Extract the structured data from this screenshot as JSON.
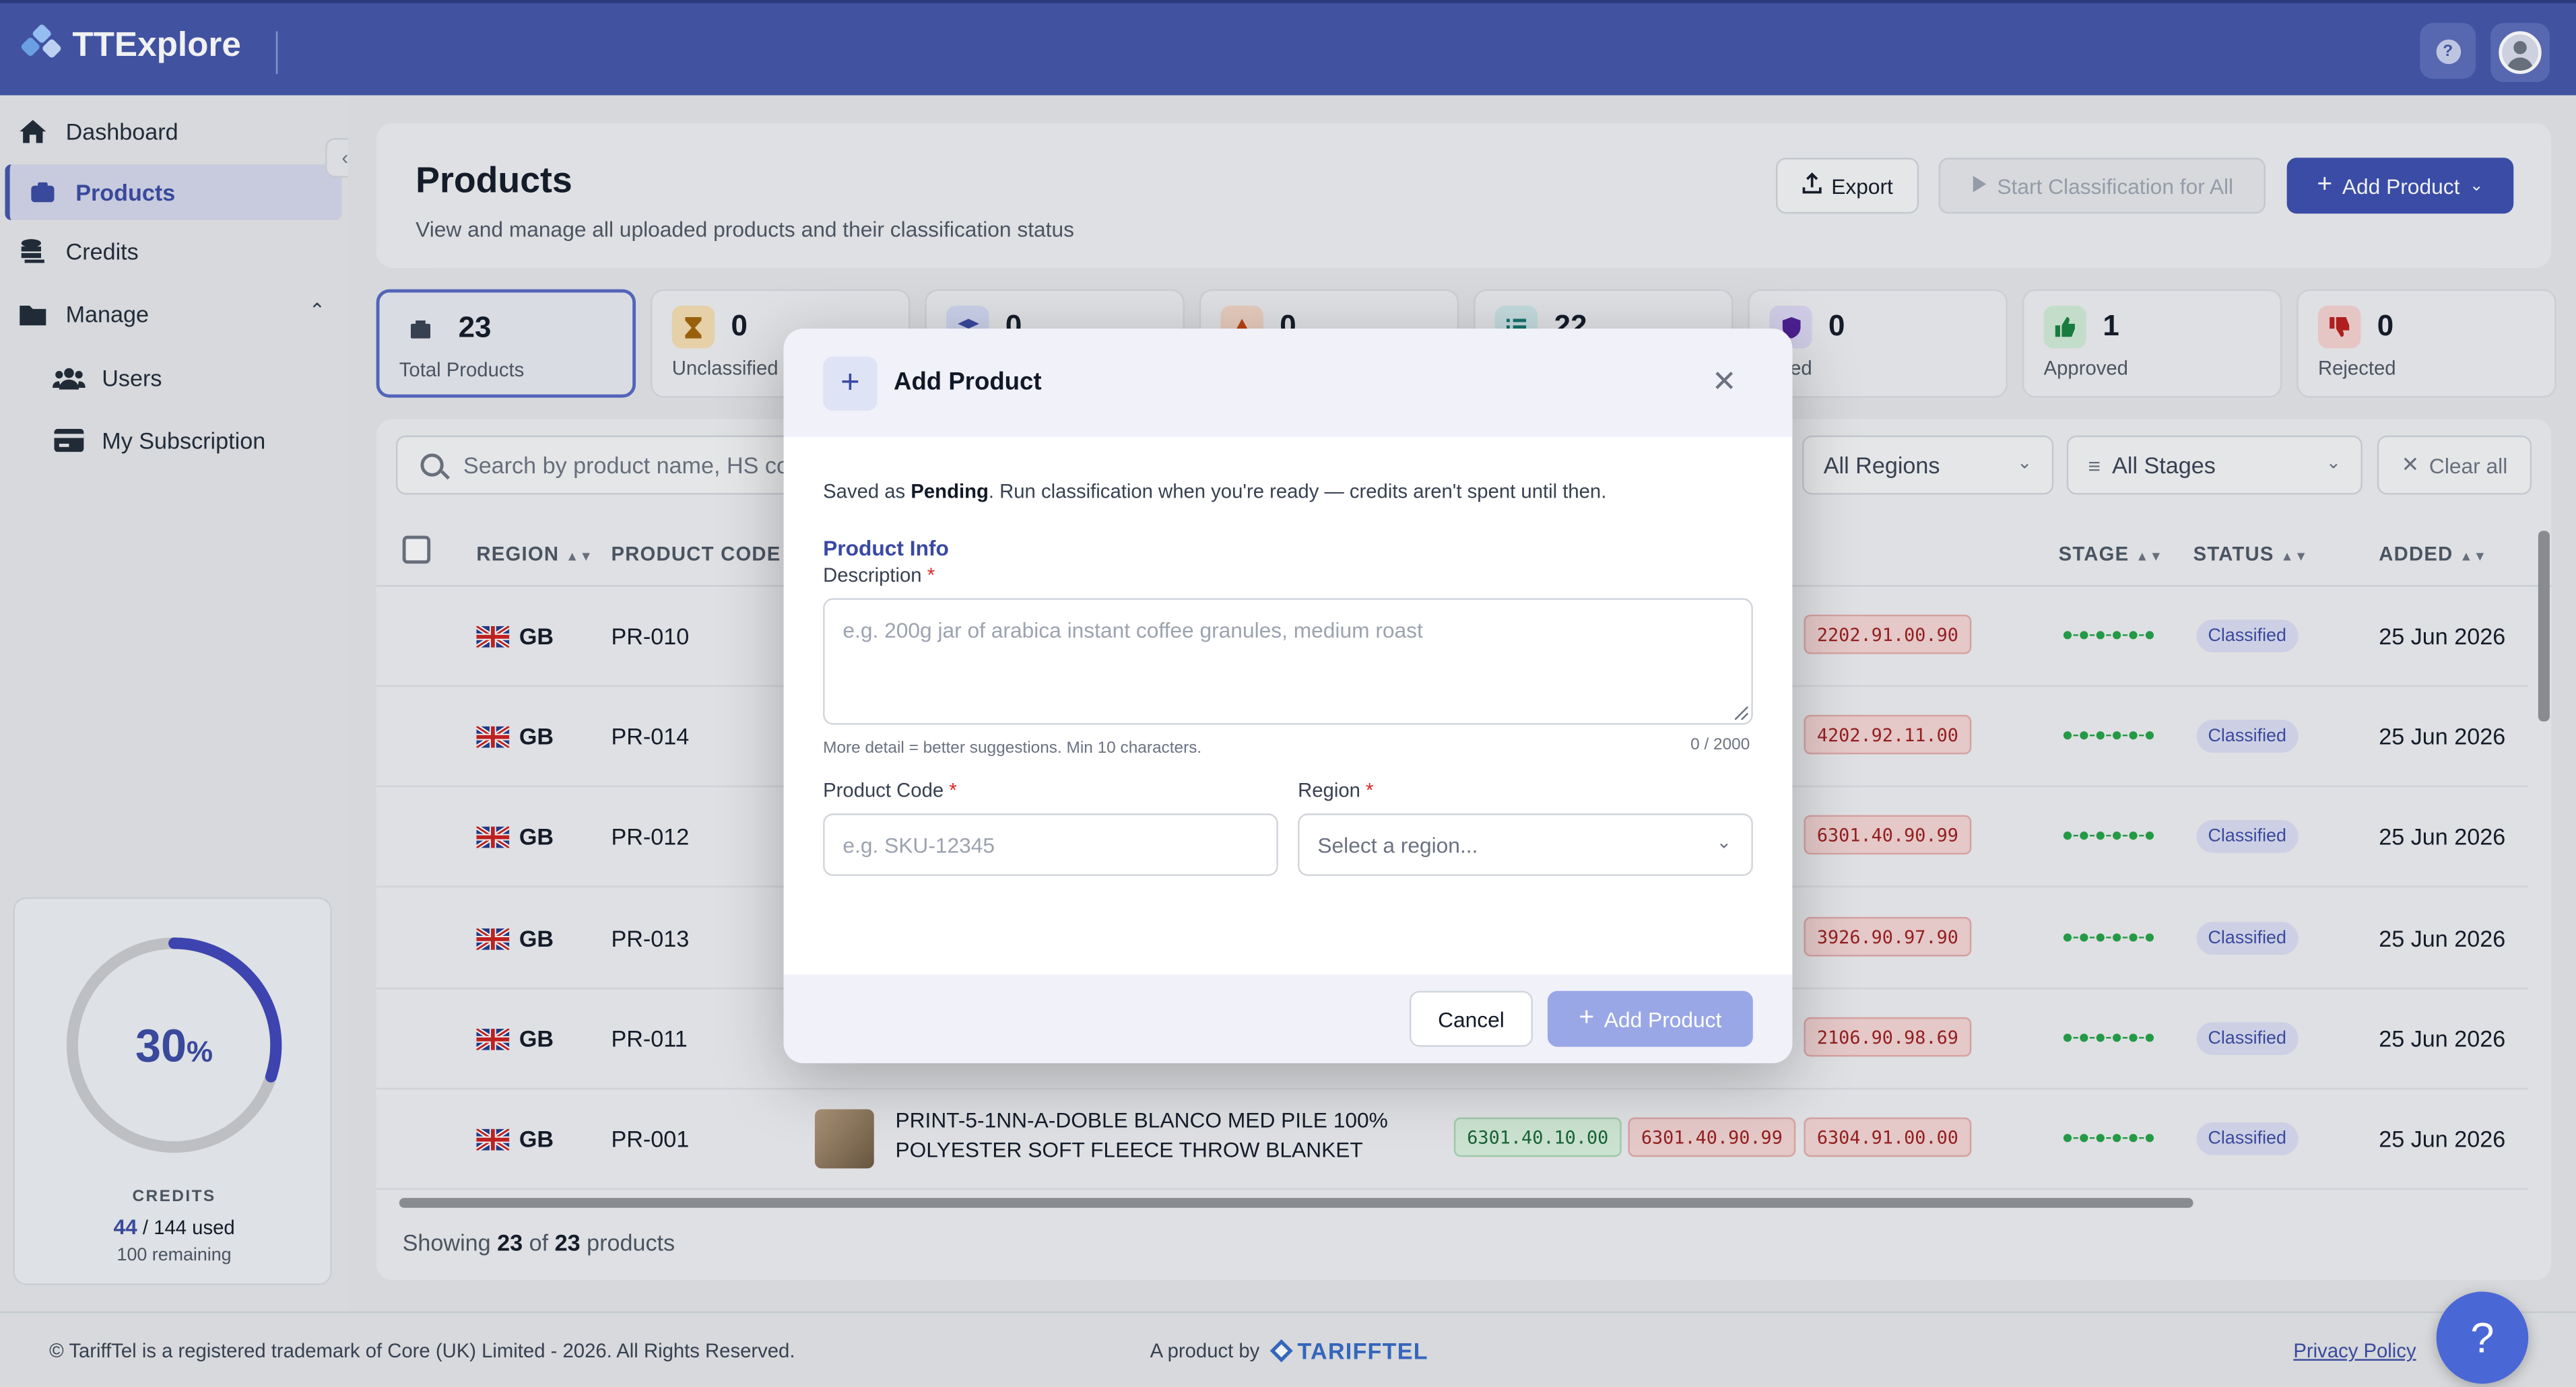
{
  "app": {
    "name": "TTExplore"
  },
  "sidebar": {
    "items": [
      {
        "label": "Dashboard"
      },
      {
        "label": "Products"
      },
      {
        "label": "Credits"
      },
      {
        "label": "Manage"
      },
      {
        "label": "Users"
      },
      {
        "label": "My Subscription"
      }
    ],
    "credits": {
      "percent_label": "30",
      "percent_sign": "%",
      "title": "CREDITS",
      "used": "44",
      "total_text": "144 used",
      "remaining": "100 remaining",
      "used_fraction": 0.3
    }
  },
  "header": {
    "title": "Products",
    "subtitle": "View and manage all uploaded products and their classification status",
    "export_label": "Export",
    "start_label": "Start Classification for All",
    "add_label": "Add Product"
  },
  "stats": [
    {
      "value": "23",
      "label": "Total Products"
    },
    {
      "value": "0",
      "label": "Unclassified"
    },
    {
      "value": "0",
      "label": ""
    },
    {
      "value": "0",
      "label": ""
    },
    {
      "value": "22",
      "label": ""
    },
    {
      "value": "0",
      "label": "rified"
    },
    {
      "value": "1",
      "label": "Approved"
    },
    {
      "value": "0",
      "label": "Rejected"
    }
  ],
  "filters": {
    "search_placeholder": "Search by product name, HS co",
    "regions": "All Regions",
    "stages": "All Stages",
    "clear": "Clear all"
  },
  "table": {
    "headers": {
      "region": "REGION",
      "code": "PRODUCT CODE",
      "stage": "STAGE",
      "status": "STATUS",
      "added": "ADDED"
    },
    "rows": [
      {
        "region": "GB",
        "code": "PR-010",
        "hs": [
          "2202.91.00.90"
        ],
        "status": "Classified",
        "added": "25 Jun 2026"
      },
      {
        "region": "GB",
        "code": "PR-014",
        "hs": [
          "4202.92.11.00"
        ],
        "status": "Classified",
        "added": "25 Jun 2026"
      },
      {
        "region": "GB",
        "code": "PR-012",
        "hs": [
          "6301.40.90.99"
        ],
        "status": "Classified",
        "added": "25 Jun 2026"
      },
      {
        "region": "GB",
        "code": "PR-013",
        "hs": [
          "3926.90.97.90"
        ],
        "status": "Classified",
        "added": "25 Jun 2026"
      },
      {
        "region": "GB",
        "code": "PR-011",
        "hs": [
          "2106.90.98.69"
        ],
        "status": "Classified",
        "added": "25 Jun 2026"
      },
      {
        "region": "GB",
        "code": "PR-001",
        "description": "PRINT-5-1NN-A-DOBLE BLANCO MED PILE 100% POLYESTER SOFT FLEECE THROW BLANKET",
        "hs": [
          "6301.40.10.00",
          "6301.40.90.99",
          "6304.91.00.00"
        ],
        "status": "Classified",
        "added": "25 Jun 2026"
      }
    ],
    "showing_prefix": "Showing",
    "showing_count": "23",
    "showing_of": "of",
    "showing_total": "23",
    "showing_suffix": "products"
  },
  "modal": {
    "title": "Add Product",
    "note_prefix": "Saved as",
    "note_status": "Pending",
    "note_suffix": ". Run classification when you're ready — credits aren't spent until then.",
    "section": "Product Info",
    "description_label": "Description",
    "description_placeholder": "e.g. 200g jar of arabica instant coffee granules, medium roast",
    "hint": "More detail = better suggestions. Min 10 characters.",
    "counter": "0 / 2000",
    "code_label": "Product Code",
    "code_placeholder": "e.g. SKU-12345",
    "region_label": "Region",
    "region_placeholder": "Select a region...",
    "cancel": "Cancel",
    "submit": "Add Product",
    "required_mark": "*"
  },
  "footer": {
    "copyright": "© TariffTel is a registered trademark of Core (UK) Limited - 2026. All Rights Reserved.",
    "product_by": "A product by",
    "brand": "TARIFFTEL",
    "privacy": "Privacy Policy",
    "help": "?"
  },
  "colors": {
    "primary": "#4153a8",
    "accent": "#3a4dae",
    "danger": "#9b1c1c",
    "success": "#166534"
  }
}
